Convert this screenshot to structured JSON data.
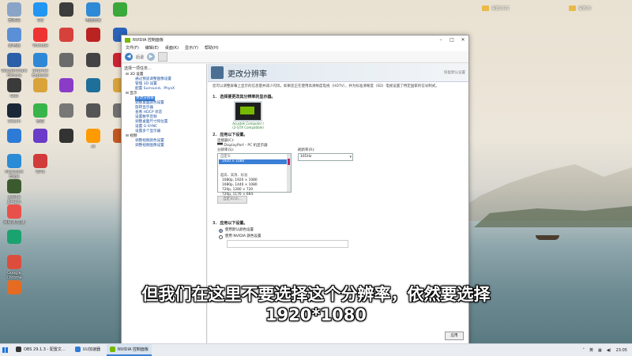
{
  "desktop": {
    "icons": [
      {
        "label": "回收站",
        "color": "#8aa4c8"
      },
      {
        "label": "此电脑",
        "color": "#5b8fd6"
      },
      {
        "label": "Wondershare Filmora",
        "color": "#2b5fa8"
      },
      {
        "label": "OBS",
        "color": "#3a3a3a"
      },
      {
        "label": "Steam",
        "color": "#1b2838"
      },
      {
        "label": "",
        "color": "#2d7bd6"
      },
      {
        "label": "Microsoft Edge",
        "color": "#2a8bd6"
      },
      {
        "label": "Adobe Dream Preview",
        "color": "#3b5b2f"
      },
      {
        "label": "网易UU加速",
        "color": "#e8514a"
      },
      {
        "label": "",
        "color": "#1aa36e"
      },
      {
        "label": "Google Chrome",
        "color": "#dd4d3c"
      },
      {
        "label": "",
        "color": "#e56b22"
      },
      {
        "label": "QQ",
        "color": "#2196f3"
      },
      {
        "label": "Youtube",
        "color": "#e33"
      },
      {
        "label": "Internet Explorer",
        "color": "#2f88d6"
      },
      {
        "label": "",
        "color": "#d9a33a"
      },
      {
        "label": "微信",
        "color": "#38b54a"
      },
      {
        "label": "",
        "color": "#6a3cc7"
      },
      {
        "label": "WPS",
        "color": "#d23b3b"
      },
      {
        "label": "",
        "color": "#3c3c3c"
      },
      {
        "label": "",
        "color": "#d6413b"
      },
      {
        "label": "",
        "color": "#6b6b6b"
      },
      {
        "label": "",
        "color": "#8a3cc7"
      },
      {
        "label": "",
        "color": "#777"
      },
      {
        "label": "",
        "color": "#333"
      },
      {
        "label": "电脑管家",
        "color": "#2e8ad6"
      },
      {
        "label": "",
        "color": "#b22"
      },
      {
        "label": "",
        "color": "#444"
      },
      {
        "label": "",
        "color": "#1f6f9b"
      },
      {
        "label": "",
        "color": "#555"
      },
      {
        "label": "Ai",
        "color": "#ff9a00"
      },
      {
        "label": "",
        "color": "#3aa83a"
      },
      {
        "label": "",
        "color": "#2a63b8"
      },
      {
        "label": "",
        "color": "#c23"
      },
      {
        "label": "",
        "color": "#d9a33a"
      },
      {
        "label": "",
        "color": "#6f6f6f"
      },
      {
        "label": "",
        "color": "#c2571f"
      }
    ],
    "folders": [
      {
        "label": "设置2022"
      },
      {
        "label": "设置20"
      }
    ]
  },
  "window": {
    "title": "NVIDIA 控制面板",
    "menu": [
      "文件(F)",
      "编辑(E)",
      "桌面(K)",
      "显示(Y)",
      "帮助(H)"
    ],
    "back_label": "后退",
    "sidebar": {
      "heading": "选择一项任务...",
      "tree": [
        {
          "t": "3D 设置",
          "cat": true
        },
        {
          "t": "通过预览调整图像设置"
        },
        {
          "t": "管理 3D 设置"
        },
        {
          "t": "配置 Surround、PhysX"
        },
        {
          "t": "显示",
          "cat": true
        },
        {
          "t": "更改分辨率",
          "sel": true
        },
        {
          "t": "调整桌面颜色设置"
        },
        {
          "t": "旋转显示器"
        },
        {
          "t": "查看 HDCP 状态"
        },
        {
          "t": "设置数字音频"
        },
        {
          "t": "调整桌面尺寸和位置"
        },
        {
          "t": "设置 G-SYNC"
        },
        {
          "t": "设置多个显示器"
        },
        {
          "t": "视频",
          "cat": true
        },
        {
          "t": "调整视频颜色设置"
        },
        {
          "t": "调整视频图像设置"
        }
      ]
    },
    "page": {
      "title": "更改分辨率",
      "restore_link": "恢复默认设置",
      "desc": "您可以调整屏幕上显示的信息量并减少闪烁。如果您正在使用高清晰度电视（HDTV），并为标准清晰度（SD）电视设置了特定国家的信号制式。",
      "step1": "选择要更改其分辨率的显示器。",
      "display_label": "Acustek Computer I (2-GTX Compatible)",
      "step2": "应用以下设置。",
      "conn_label": "连接器(C):",
      "conn_value": "DisplayPort - PC 机显示器",
      "res_label": "分辨率(S):",
      "refresh_label": "刷新率(R):",
      "refresh_value": "165Hz",
      "res_list": [
        {
          "t": "自定义",
          "hdr": true
        },
        {
          "t": "1920 × 1080",
          "sel": true
        },
        {
          "t": ""
        },
        {
          "t": ""
        },
        {
          "t": "超高、高清、标准",
          "hdr": true
        },
        {
          "t": "1080p, 1920 × 1080"
        },
        {
          "t": "1080p, 1440 × 1080"
        },
        {
          "t": "720p, 1280 × 720"
        },
        {
          "t": "720p, 1176 × 664"
        }
      ],
      "custom_btn": "自定义(U)...",
      "step3": "应用以下设置。",
      "radio1": "使用默认颜色设置",
      "radio2": "使用 NVIDIA 颜色设置",
      "apply_label": "应用"
    }
  },
  "subtitle": {
    "line1": "但我们在这里不要选择这个分辨率，依然要选择",
    "line2": "1920*1080"
  },
  "taskbar": {
    "apps": [
      {
        "label": "OBS 29.1.3 - 配置文...",
        "color": "#333",
        "active": false
      },
      {
        "label": "UU加速器",
        "color": "#2d7bd6",
        "active": false
      },
      {
        "label": "NVIDIA 控制面板",
        "color": "#76b900",
        "active": true
      }
    ],
    "lang": "英",
    "time": "23:05"
  }
}
